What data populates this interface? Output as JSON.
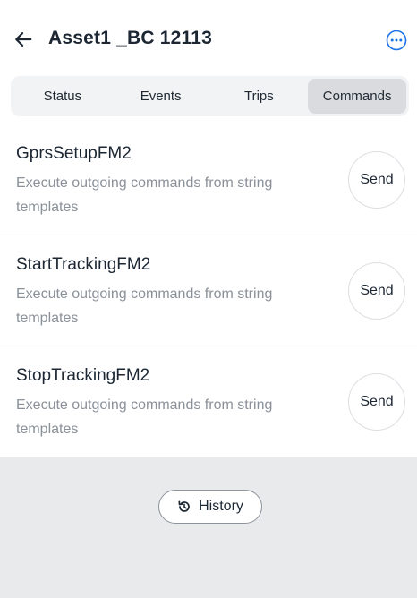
{
  "header": {
    "title": "Asset1 _BC 12113",
    "back_icon": "arrow-left-icon",
    "more_icon": "more-horizontal-circle-icon",
    "accent_color": "#1a73e8"
  },
  "tabs": [
    {
      "label": "Status",
      "active": false
    },
    {
      "label": "Events",
      "active": false
    },
    {
      "label": "Trips",
      "active": false
    },
    {
      "label": "Commands",
      "active": true
    }
  ],
  "commands": [
    {
      "name": "GprsSetupFM2",
      "description": "Execute outgoing commands from string templates",
      "send_label": "Send"
    },
    {
      "name": "StartTrackingFM2",
      "description": "Execute outgoing commands from string templates",
      "send_label": "Send"
    },
    {
      "name": "StopTrackingFM2",
      "description": "Execute outgoing commands from string templates",
      "send_label": "Send"
    }
  ],
  "footer": {
    "history_label": "History",
    "history_icon": "history-icon"
  }
}
